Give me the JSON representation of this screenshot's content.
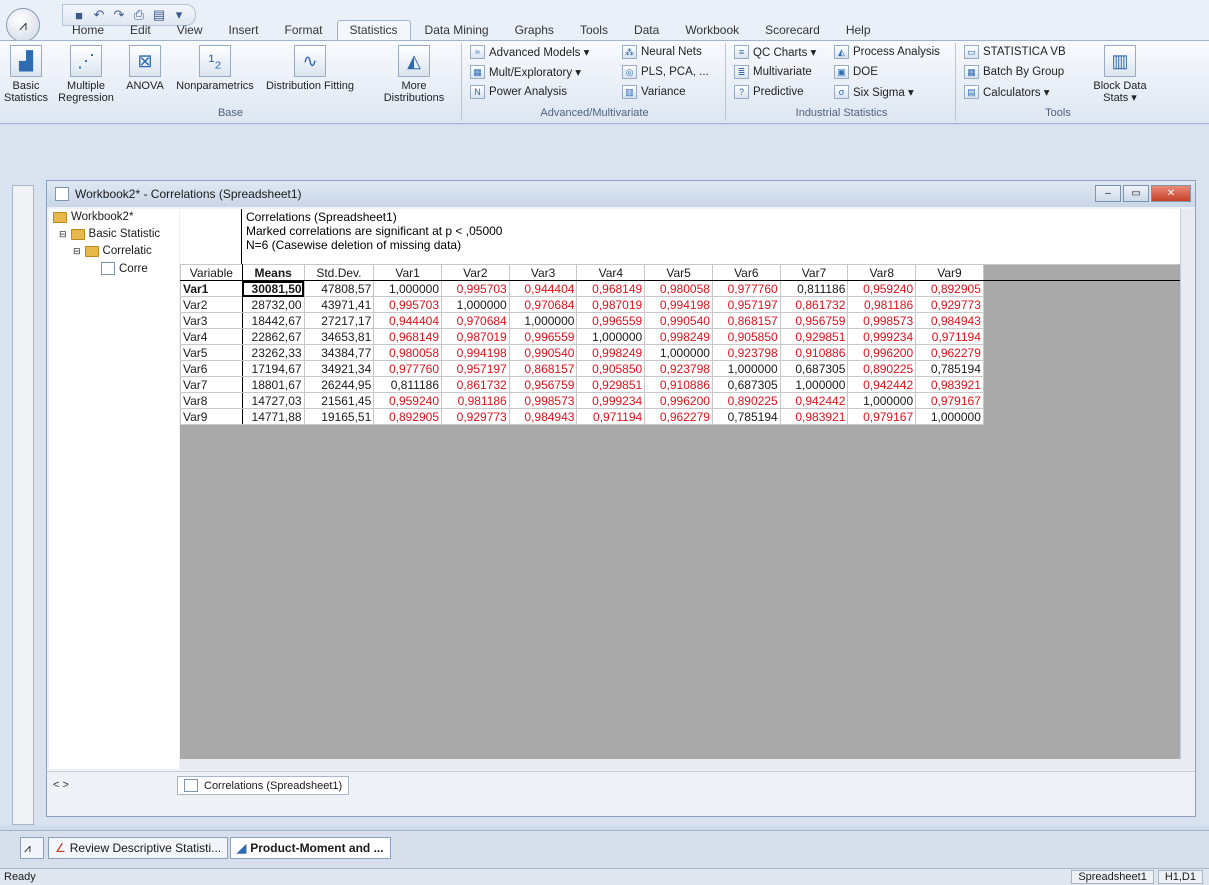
{
  "app": {
    "orb_glyph": "⩘"
  },
  "qat": {
    "icons": [
      "save-icon",
      "undo-icon",
      "redo-icon",
      "print-icon",
      "window-icon",
      "dropdown-icon"
    ]
  },
  "tabs": [
    "Home",
    "Edit",
    "View",
    "Insert",
    "Format",
    "Statistics",
    "Data Mining",
    "Graphs",
    "Tools",
    "Data",
    "Workbook",
    "Scorecard",
    "Help"
  ],
  "ribbon": {
    "base": {
      "label": "Base",
      "basic_statistics": "Basic Statistics",
      "multiple_regression": "Multiple Regression",
      "anova": "ANOVA",
      "nonparametrics": "Nonparametrics",
      "distribution_fitting": "Distribution Fitting",
      "more_distributions": "More Distributions"
    },
    "advanced": {
      "label": "Advanced/Multivariate",
      "advanced_models": "Advanced Models ▾",
      "neural_nets": "Neural Nets",
      "mult_exploratory": "Mult/Exploratory ▾",
      "pls_pca": "PLS, PCA, ...",
      "power_analysis": "Power Analysis",
      "variance": "Variance"
    },
    "industrial": {
      "label": "Industrial Statistics",
      "qc_charts": "QC Charts ▾",
      "process_analysis": "Process Analysis",
      "multivariate": "Multivariate",
      "doe": "DOE",
      "predictive": "Predictive",
      "six_sigma": "Six Sigma ▾"
    },
    "tools": {
      "label": "Tools",
      "statistica_vb": "STATISTICA VB",
      "batch_by_group": "Batch By Group",
      "calculators": "Calculators ▾",
      "block_data_stats": "Block Data Stats ▾"
    }
  },
  "window": {
    "title": "Workbook2* - Correlations (Spreadsheet1)"
  },
  "tree": {
    "root": "Workbook2*",
    "basic": "Basic Statistic",
    "correlations": "Correlatic",
    "sheet": "Corre"
  },
  "sheet": {
    "header_lines": [
      "Correlations (Spreadsheet1)",
      "Marked correlations are significant at p < ,05000",
      "N=6 (Casewise deletion of missing data)"
    ],
    "corner_label": "Variable",
    "columns": [
      "Means",
      "Std.Dev.",
      "Var1",
      "Var2",
      "Var3",
      "Var4",
      "Var5",
      "Var6",
      "Var7",
      "Var8",
      "Var9"
    ],
    "rows": [
      {
        "name": "Var1",
        "means": "30081,50",
        "std": "47808,57",
        "r": [
          "1,000000",
          "0,995703",
          "0,944404",
          "0,968149",
          "0,980058",
          "0,977760",
          "0,811186",
          "0,959240",
          "0,892905"
        ]
      },
      {
        "name": "Var2",
        "means": "28732,00",
        "std": "43971,41",
        "r": [
          "0,995703",
          "1,000000",
          "0,970684",
          "0,987019",
          "0,994198",
          "0,957197",
          "0,861732",
          "0,981186",
          "0,929773"
        ]
      },
      {
        "name": "Var3",
        "means": "18442,67",
        "std": "27217,17",
        "r": [
          "0,944404",
          "0,970684",
          "1,000000",
          "0,996559",
          "0,990540",
          "0,868157",
          "0,956759",
          "0,998573",
          "0,984943"
        ]
      },
      {
        "name": "Var4",
        "means": "22862,67",
        "std": "34653,81",
        "r": [
          "0,968149",
          "0,987019",
          "0,996559",
          "1,000000",
          "0,998249",
          "0,905850",
          "0,929851",
          "0,999234",
          "0,971194"
        ]
      },
      {
        "name": "Var5",
        "means": "23262,33",
        "std": "34384,77",
        "r": [
          "0,980058",
          "0,994198",
          "0,990540",
          "0,998249",
          "1,000000",
          "0,923798",
          "0,910886",
          "0,996200",
          "0,962279"
        ]
      },
      {
        "name": "Var6",
        "means": "17194,67",
        "std": "34921,34",
        "r": [
          "0,977760",
          "0,957197",
          "0,868157",
          "0,905850",
          "0,923798",
          "1,000000",
          "0,687305",
          "0,890225",
          "0,785194"
        ]
      },
      {
        "name": "Var7",
        "means": "18801,67",
        "std": "26244,95",
        "r": [
          "0,811186",
          "0,861732",
          "0,956759",
          "0,929851",
          "0,910886",
          "0,687305",
          "1,000000",
          "0,942442",
          "0,983921"
        ]
      },
      {
        "name": "Var8",
        "means": "14727,03",
        "std": "21561,45",
        "r": [
          "0,959240",
          "0,981186",
          "0,998573",
          "0,999234",
          "0,996200",
          "0,890225",
          "0,942442",
          "1,000000",
          "0,979167"
        ]
      },
      {
        "name": "Var9",
        "means": "14771,88",
        "std": "19165,51",
        "r": [
          "0,892905",
          "0,929773",
          "0,984943",
          "0,971194",
          "0,962279",
          "0,785194",
          "0,983921",
          "0,979167",
          "1,000000"
        ]
      }
    ],
    "significant_color": "#e0101a"
  },
  "sheet_tab": "Correlations (Spreadsheet1)",
  "sheet_nav": "<     >",
  "taskbar": {
    "items": [
      "Review Descriptive Statisti...",
      "Product-Moment and ..."
    ]
  },
  "status": {
    "left": "Ready",
    "right_1": "Spreadsheet1",
    "right_2": "H1,D1"
  }
}
